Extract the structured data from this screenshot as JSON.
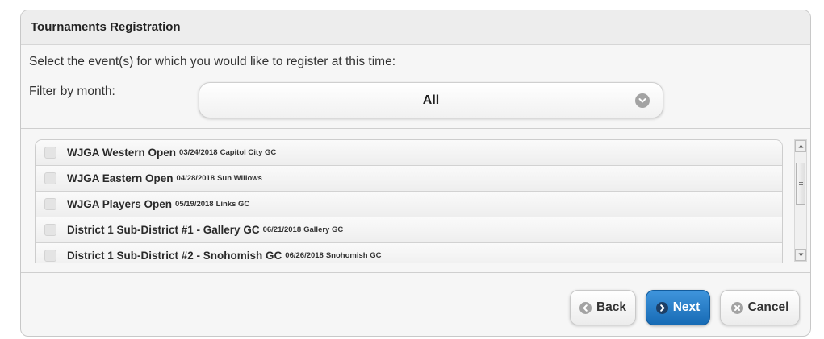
{
  "panel": {
    "title": "Tournaments Registration",
    "instruction": "Select the event(s) for which you would like to register at this time:"
  },
  "filter": {
    "label": "Filter by month:",
    "selected": "All",
    "icon": "chevron-down-circle-icon"
  },
  "events": [
    {
      "name": "WJGA Western Open",
      "date": "03/24/2018",
      "venue": "Capitol City GC",
      "checked": false
    },
    {
      "name": "WJGA Eastern Open",
      "date": "04/28/2018",
      "venue": "Sun Willows",
      "checked": false
    },
    {
      "name": "WJGA Players Open",
      "date": "05/19/2018",
      "venue": "Links GC",
      "checked": false
    },
    {
      "name": "District 1 Sub-District #1 - Gallery GC",
      "date": "06/21/2018",
      "venue": "Gallery GC",
      "checked": false
    },
    {
      "name": "District 1 Sub-District #2 - Snohomish GC",
      "date": "06/26/2018",
      "venue": "Snohomish GC",
      "checked": false
    }
  ],
  "buttons": {
    "back": {
      "label": "Back",
      "icon": "chevron-left-circle-icon"
    },
    "next": {
      "label": "Next",
      "icon": "chevron-right-circle-icon"
    },
    "cancel": {
      "label": "Cancel",
      "icon": "close-circle-icon"
    }
  },
  "colors": {
    "primary_button": "#1f74bf",
    "panel_background": "#f6f6f6",
    "header_background": "#ededed"
  }
}
